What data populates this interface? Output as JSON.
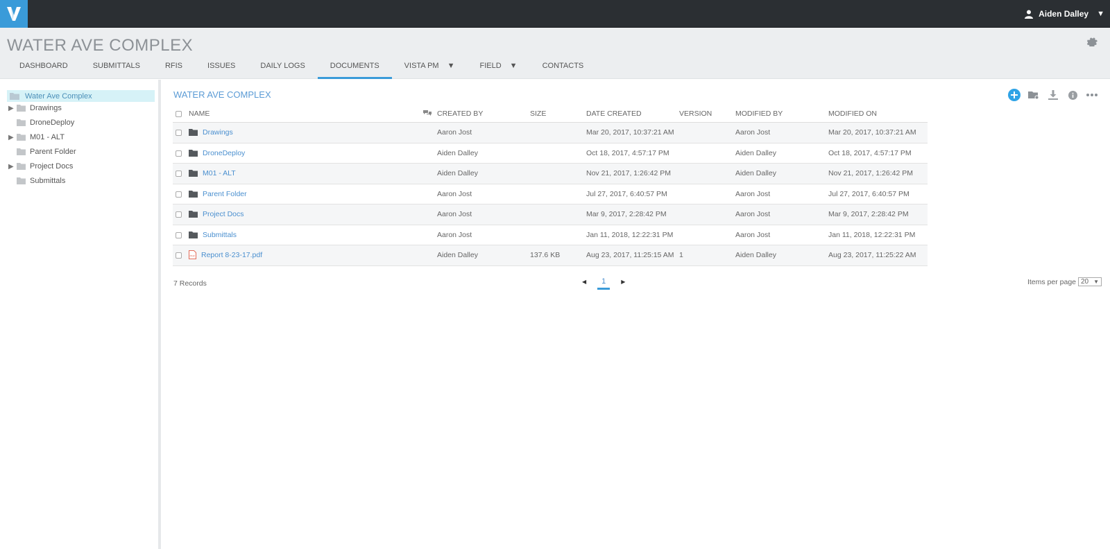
{
  "app": {
    "user_name": "Aiden Dalley",
    "project_title": "WATER AVE COMPLEX"
  },
  "nav": [
    {
      "label": "DASHBOARD"
    },
    {
      "label": "SUBMITTALS"
    },
    {
      "label": "RFIS"
    },
    {
      "label": "ISSUES"
    },
    {
      "label": "DAILY LOGS"
    },
    {
      "label": "DOCUMENTS",
      "active": true
    },
    {
      "label": "VISTA PM",
      "dropdown": true
    },
    {
      "label": "FIELD",
      "dropdown": true
    },
    {
      "label": "CONTACTS"
    }
  ],
  "tree": {
    "root": "Water Ave Complex",
    "nodes": [
      {
        "label": "Drawings",
        "expandable": true
      },
      {
        "label": "DroneDeploy",
        "expandable": false
      },
      {
        "label": "M01 - ALT",
        "expandable": true
      },
      {
        "label": "Parent Folder",
        "expandable": false
      },
      {
        "label": "Project Docs",
        "expandable": true
      },
      {
        "label": "Submittals",
        "expandable": false
      }
    ]
  },
  "main": {
    "title": "WATER AVE COMPLEX",
    "columns": {
      "name": "NAME",
      "created_by": "CREATED BY",
      "size": "SIZE",
      "date_created": "DATE CREATED",
      "version": "VERSION",
      "modified_by": "MODIFIED BY",
      "modified_on": "MODIFIED ON"
    },
    "rows": [
      {
        "type": "folder",
        "name": "Drawings",
        "created_by": "Aaron Jost",
        "size": "",
        "date_created": "Mar 20, 2017, 10:37:21 AM",
        "version": "",
        "modified_by": "Aaron Jost",
        "modified_on": "Mar 20, 2017, 10:37:21 AM"
      },
      {
        "type": "folder",
        "name": "DroneDeploy",
        "created_by": "Aiden Dalley",
        "size": "",
        "date_created": "Oct 18, 2017, 4:57:17 PM",
        "version": "",
        "modified_by": "Aiden Dalley",
        "modified_on": "Oct 18, 2017, 4:57:17 PM"
      },
      {
        "type": "folder",
        "name": "M01 - ALT",
        "created_by": "Aiden Dalley",
        "size": "",
        "date_created": "Nov 21, 2017, 1:26:42 PM",
        "version": "",
        "modified_by": "Aiden Dalley",
        "modified_on": "Nov 21, 2017, 1:26:42 PM"
      },
      {
        "type": "folder",
        "name": "Parent Folder",
        "created_by": "Aaron Jost",
        "size": "",
        "date_created": "Jul 27, 2017, 6:40:57 PM",
        "version": "",
        "modified_by": "Aaron Jost",
        "modified_on": "Jul 27, 2017, 6:40:57 PM"
      },
      {
        "type": "folder",
        "name": "Project Docs",
        "created_by": "Aaron Jost",
        "size": "",
        "date_created": "Mar 9, 2017, 2:28:42 PM",
        "version": "",
        "modified_by": "Aaron Jost",
        "modified_on": "Mar 9, 2017, 2:28:42 PM"
      },
      {
        "type": "folder",
        "name": "Submittals",
        "created_by": "Aaron Jost",
        "size": "",
        "date_created": "Jan 11, 2018, 12:22:31 PM",
        "version": "",
        "modified_by": "Aaron Jost",
        "modified_on": "Jan 11, 2018, 12:22:31 PM"
      },
      {
        "type": "pdf",
        "name": "Report 8-23-17.pdf",
        "created_by": "Aiden Dalley",
        "size": "137.6 KB",
        "date_created": "Aug 23, 2017, 11:25:15 AM",
        "version": "1",
        "modified_by": "Aiden Dalley",
        "modified_on": "Aug 23, 2017, 11:25:22 AM"
      }
    ],
    "records_label": "7 Records",
    "pagination": {
      "current_page": "1"
    },
    "items_per_page": {
      "label": "Items per page",
      "value": "20"
    }
  },
  "colors": {
    "accent": "#3a9bd9",
    "topbar": "#2b2f33",
    "link": "#4a8fcf"
  }
}
